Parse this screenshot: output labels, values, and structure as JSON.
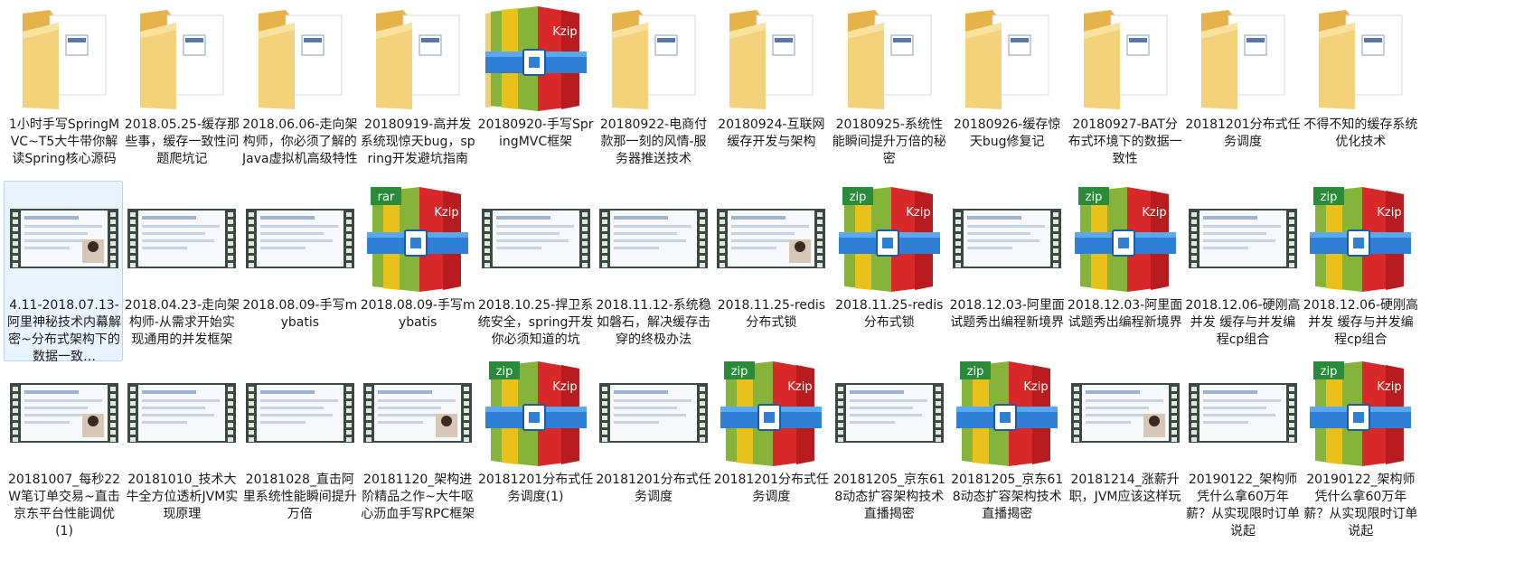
{
  "view": "explorer-large-icons",
  "colors": {
    "selection": "#e9f3fd",
    "folder": "#f2cf74",
    "archive_red": "#d8282a"
  },
  "items": [
    {
      "name": "1小时手写SpringMVC~T5大牛带你解读Spring核心源码",
      "type": "folder",
      "icon": "folder-icon"
    },
    {
      "name": "2018.05.25-缓存那些事，缓存一致性问题爬坑记",
      "type": "folder",
      "icon": "folder-icon"
    },
    {
      "name": "2018.06.06-走向架构师，你必须了解的Java虚拟机高级特性",
      "type": "folder",
      "icon": "folder-icon"
    },
    {
      "name": "20180919-高并发系统现惊天bug，spring开发避坑指南",
      "type": "folder",
      "icon": "folder-icon"
    },
    {
      "name": "20180920-手写SpringMVC框架",
      "type": "folder-archive",
      "icon": "kzip-folder-icon"
    },
    {
      "name": "20180922-电商付款那一刻的风情-服务器推送技术",
      "type": "folder",
      "icon": "folder-icon"
    },
    {
      "name": "20180924-互联网缓存开发与架构",
      "type": "folder",
      "icon": "folder-icon"
    },
    {
      "name": "20180925-系统性能瞬间提升万倍的秘密",
      "type": "folder",
      "icon": "folder-icon"
    },
    {
      "name": "20180926-缓存惊天bug修复记",
      "type": "folder",
      "icon": "folder-icon"
    },
    {
      "name": "20180927-BAT分布式环境下的数据一致性",
      "type": "folder",
      "icon": "folder-icon"
    },
    {
      "name": "20181201分布式任务调度",
      "type": "folder",
      "icon": "folder-icon"
    },
    {
      "name": "不得不知的缓存系统优化技术",
      "type": "folder",
      "icon": "folder-icon"
    },
    {
      "name": "4.11-2018.07.13-阿里神秘技术内幕解密~分布式架构下的数据一致…",
      "type": "video",
      "icon": "video-thumbnail-icon",
      "selected": true
    },
    {
      "name": "2018.04.23-走向架构师-从需求开始实现通用的并发框架",
      "type": "video",
      "icon": "video-thumbnail-icon"
    },
    {
      "name": "2018.08.09-手写mybatis",
      "type": "video",
      "icon": "video-thumbnail-icon"
    },
    {
      "name": "2018.08.09-手写mybatis",
      "type": "archive",
      "icon": "kzip-archive-icon",
      "badge": "rar"
    },
    {
      "name": "2018.10.25-捍卫系统安全，spring开发你必须知道的坑",
      "type": "video",
      "icon": "video-thumbnail-icon"
    },
    {
      "name": "2018.11.12-系统稳如磐石，解决缓存击穿的终极办法",
      "type": "video",
      "icon": "video-thumbnail-icon"
    },
    {
      "name": "2018.11.25-redis分布式锁",
      "type": "video",
      "icon": "video-thumbnail-icon"
    },
    {
      "name": "2018.11.25-redis分布式锁",
      "type": "archive",
      "icon": "kzip-archive-icon",
      "badge": "zip"
    },
    {
      "name": "2018.12.03-阿里面试题秀出编程新境界",
      "type": "video",
      "icon": "video-thumbnail-icon"
    },
    {
      "name": "2018.12.03-阿里面试题秀出编程新境界",
      "type": "archive",
      "icon": "kzip-archive-icon",
      "badge": "zip"
    },
    {
      "name": "2018.12.06-硬刚高并发 缓存与并发编程cp组合",
      "type": "video",
      "icon": "video-thumbnail-icon"
    },
    {
      "name": "2018.12.06-硬刚高并发 缓存与并发编程cp组合",
      "type": "archive",
      "icon": "kzip-archive-icon",
      "badge": "zip"
    },
    {
      "name": "20181007_每秒22W笔订单交易~直击京东平台性能调优(1)",
      "type": "video",
      "icon": "video-thumbnail-icon"
    },
    {
      "name": "20181010_技术大牛全方位透析JVM实现原理",
      "type": "video",
      "icon": "video-thumbnail-icon"
    },
    {
      "name": "20181028_直击阿里系统性能瞬间提升万倍",
      "type": "video",
      "icon": "video-thumbnail-icon"
    },
    {
      "name": "20181120_架构进阶精品之作~大牛呕心沥血手写RPC框架",
      "type": "video",
      "icon": "video-thumbnail-icon"
    },
    {
      "name": "20181201分布式任务调度(1)",
      "type": "archive",
      "icon": "kzip-archive-icon",
      "badge": "zip"
    },
    {
      "name": "20181201分布式任务调度",
      "type": "video",
      "icon": "video-thumbnail-icon"
    },
    {
      "name": "20181201分布式任务调度",
      "type": "archive",
      "icon": "kzip-archive-icon",
      "badge": "zip"
    },
    {
      "name": "20181205_京东618动态扩容架构技术直播揭密",
      "type": "video",
      "icon": "video-thumbnail-icon"
    },
    {
      "name": "20181205_京东618动态扩容架构技术直播揭密",
      "type": "archive",
      "icon": "kzip-archive-icon",
      "badge": "zip"
    },
    {
      "name": "20181214_涨薪升职，JVM应该这样玩",
      "type": "video",
      "icon": "video-thumbnail-icon"
    },
    {
      "name": "20190122_架构师凭什么拿60万年薪？从实现限时订单说起",
      "type": "video",
      "icon": "video-thumbnail-icon"
    },
    {
      "name": "20190122_架构师凭什么拿60万年薪？从实现限时订单说起",
      "type": "archive",
      "icon": "kzip-archive-icon",
      "badge": "zip"
    }
  ]
}
